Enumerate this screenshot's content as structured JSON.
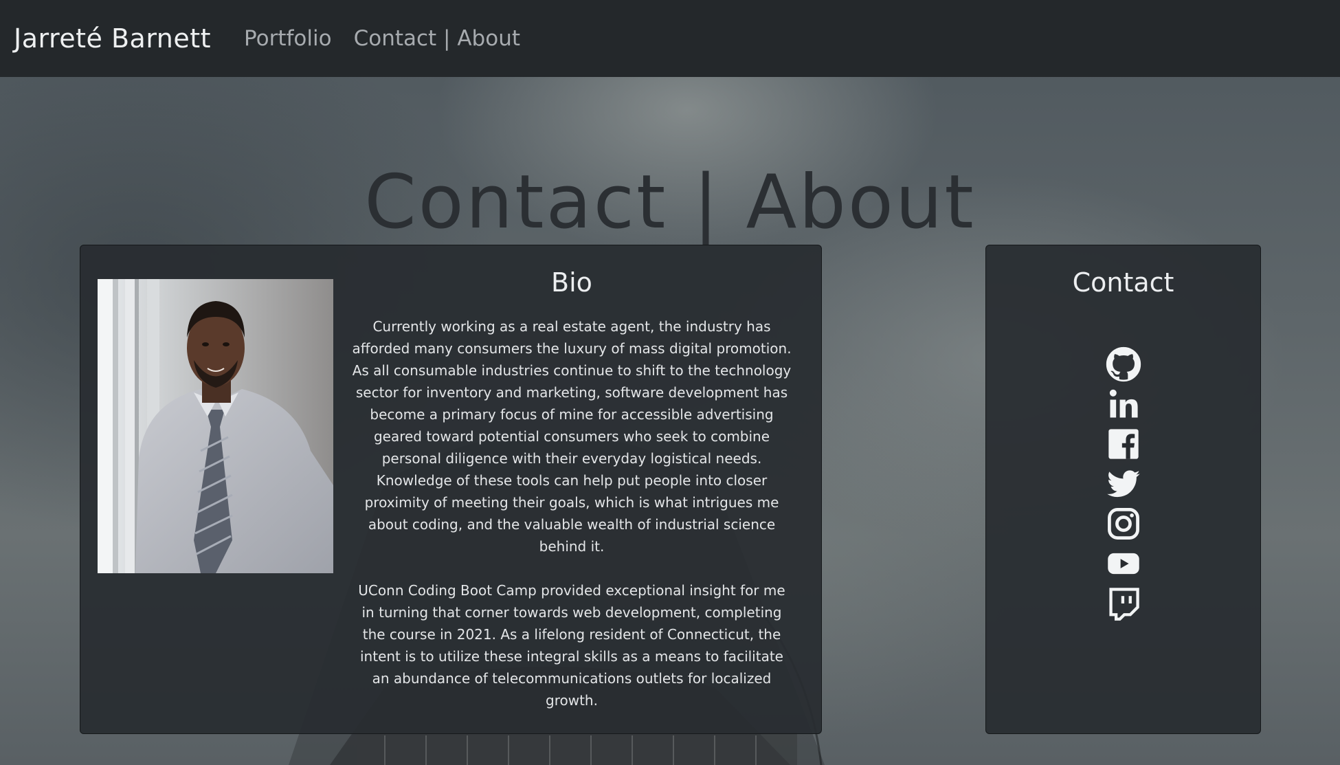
{
  "navbar": {
    "brand": "Jarreté Barnett",
    "links": [
      {
        "label": "Portfolio"
      },
      {
        "label": "Contact | About"
      }
    ]
  },
  "page": {
    "title": "Contact | About"
  },
  "bio": {
    "heading": "Bio",
    "paragraphs": [
      "Currently working as a real estate agent, the industry has afforded many consumers the luxury of mass digital promotion. As all consumable industries continue to shift to the technology sector for inventory and marketing, software development has become a primary focus of mine for accessible advertising geared toward potential consumers who seek to combine personal diligence with their everyday logistical needs. Knowledge of these tools can help put people into closer proximity of meeting their goals, which is what intrigues me about coding, and the valuable wealth of industrial science behind it.",
      "UConn Coding Boot Camp provided exceptional insight for me in turning that corner towards web development, completing the course in 2021. As a lifelong resident of Connecticut, the intent is to utilize these integral skills as a means to facilitate an abundance of telecommunications outlets for localized growth."
    ]
  },
  "contact": {
    "heading": "Contact",
    "icons": [
      "github-icon",
      "linkedin-icon",
      "facebook-icon",
      "twitter-icon",
      "instagram-icon",
      "youtube-icon",
      "twitch-icon"
    ]
  },
  "colors": {
    "navbar_bg": "#24282b",
    "card_bg": "#282c30",
    "title_color": "#2b2f33",
    "text": "#e4e6e8"
  }
}
